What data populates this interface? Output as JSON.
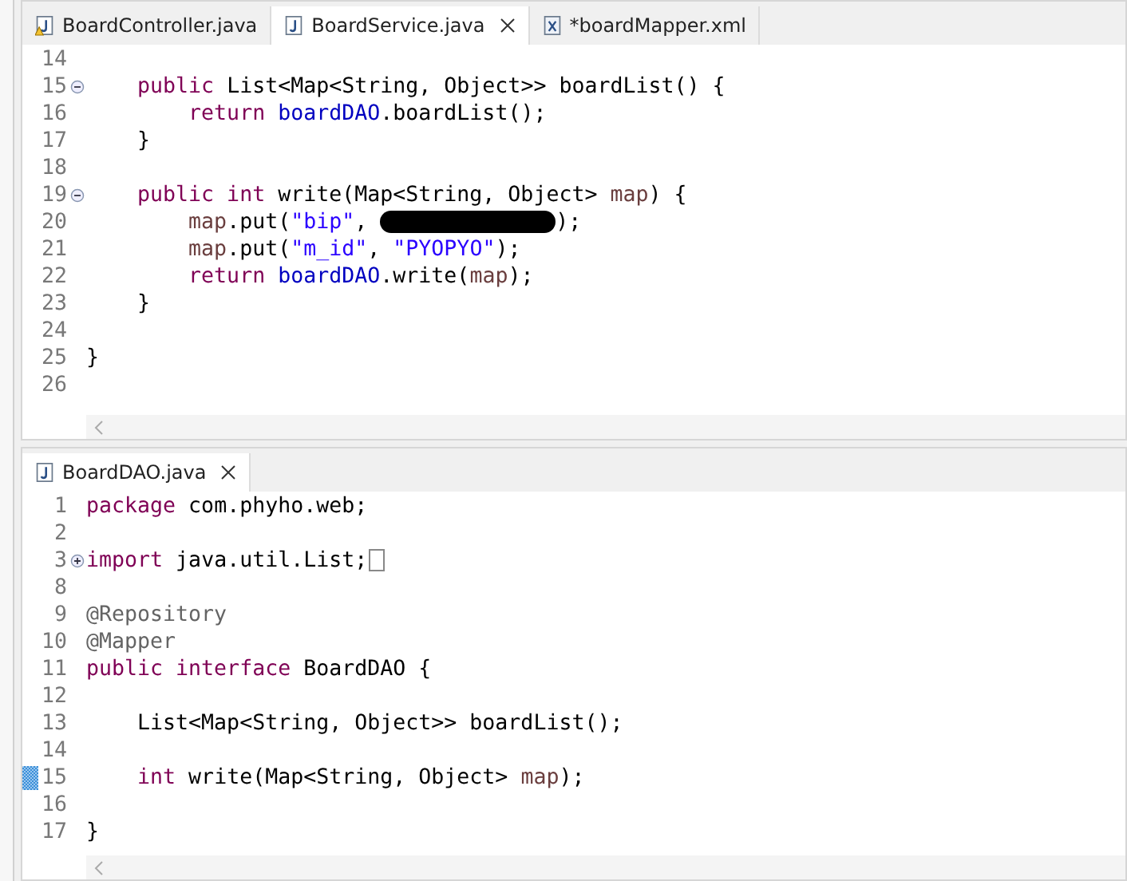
{
  "editors": [
    {
      "tabs": [
        {
          "label": "BoardController.java",
          "kind": "java",
          "warning": true,
          "selected": false
        },
        {
          "label": "BoardService.java",
          "kind": "java",
          "warning": false,
          "selected": true
        },
        {
          "label": "*boardMapper.xml",
          "kind": "xml",
          "warning": false,
          "selected": false
        }
      ],
      "lines": [
        {
          "number": "14"
        },
        {
          "number": "15",
          "expanded": true,
          "tokens": [
            {
              "text": "    public",
              "kind": "keyword"
            },
            {
              "text": " List<Map<String, Object>> boardList() {",
              "kind": "plain"
            }
          ]
        },
        {
          "number": "16",
          "tokens": [
            {
              "text": "        return",
              "kind": "keyword"
            },
            {
              "text": " boardDAO",
              "kind": "field"
            },
            {
              "text": ".boardList();",
              "kind": "plain"
            }
          ]
        },
        {
          "number": "17",
          "tokens": [
            {
              "text": "    }",
              "kind": "plain"
            }
          ]
        },
        {
          "number": "18"
        },
        {
          "number": "19",
          "expanded": true,
          "tokens": [
            {
              "text": "    public int",
              "kind": "keyword"
            },
            {
              "text": " write(Map<String, Object> ",
              "kind": "plain"
            },
            {
              "text": "map",
              "kind": "param"
            },
            {
              "text": ") {",
              "kind": "plain"
            }
          ]
        },
        {
          "number": "20",
          "tokens": [
            {
              "text": "        map",
              "kind": "param"
            },
            {
              "text": ".put(",
              "kind": "plain"
            },
            {
              "text": "\"bip\"",
              "kind": "string"
            },
            {
              "text": ", ",
              "kind": "plain"
            },
            {
              "kind": "redacted"
            },
            {
              "text": ");",
              "kind": "plain"
            }
          ]
        },
        {
          "number": "21",
          "tokens": [
            {
              "text": "        map",
              "kind": "param"
            },
            {
              "text": ".put(",
              "kind": "plain"
            },
            {
              "text": "\"m_id\"",
              "kind": "string"
            },
            {
              "text": ", ",
              "kind": "plain"
            },
            {
              "text": "\"PYOPYO\"",
              "kind": "string"
            },
            {
              "text": ");",
              "kind": "plain"
            }
          ]
        },
        {
          "number": "22",
          "tokens": [
            {
              "text": "        return",
              "kind": "keyword"
            },
            {
              "text": " boardDAO",
              "kind": "field"
            },
            {
              "text": ".write(",
              "kind": "plain"
            },
            {
              "text": "map",
              "kind": "param"
            },
            {
              "text": ");",
              "kind": "plain"
            }
          ]
        },
        {
          "number": "23",
          "tokens": [
            {
              "text": "    }",
              "kind": "plain"
            }
          ]
        },
        {
          "number": "24"
        },
        {
          "number": "25",
          "tokens": [
            {
              "text": "}",
              "kind": "plain"
            }
          ]
        },
        {
          "number": "26"
        }
      ]
    },
    {
      "tabs": [
        {
          "label": "BoardDAO.java",
          "kind": "java",
          "warning": false,
          "selected": true
        }
      ],
      "lines": [
        {
          "number": "1",
          "tokens": [
            {
              "text": "package",
              "kind": "keyword"
            },
            {
              "text": " com.phyho.web;",
              "kind": "plain"
            }
          ]
        },
        {
          "number": "2"
        },
        {
          "number": "3",
          "expanded": false,
          "tokens": [
            {
              "text": "import",
              "kind": "keyword"
            },
            {
              "text": " java.util.List;",
              "kind": "plain"
            },
            {
              "kind": "folded"
            }
          ]
        },
        {
          "number": "8"
        },
        {
          "number": "9",
          "tokens": [
            {
              "text": "@Repository",
              "kind": "annotation"
            }
          ]
        },
        {
          "number": "10",
          "tokens": [
            {
              "text": "@Mapper",
              "kind": "annotation"
            }
          ]
        },
        {
          "number": "11",
          "tokens": [
            {
              "text": "public interface",
              "kind": "keyword"
            },
            {
              "text": " BoardDAO {",
              "kind": "plain"
            }
          ]
        },
        {
          "number": "12"
        },
        {
          "number": "13",
          "tokens": [
            {
              "text": "    List<Map<String, Object>> boardList();",
              "kind": "plain"
            }
          ]
        },
        {
          "number": "14"
        },
        {
          "number": "15",
          "marker": true,
          "tokens": [
            {
              "text": "    int",
              "kind": "keyword"
            },
            {
              "text": " write(Map<String, Object> ",
              "kind": "plain"
            },
            {
              "text": "map",
              "kind": "param"
            },
            {
              "text": ");",
              "kind": "plain"
            }
          ]
        },
        {
          "number": "16"
        },
        {
          "number": "17",
          "tokens": [
            {
              "text": "}",
              "kind": "plain"
            }
          ]
        }
      ]
    }
  ]
}
